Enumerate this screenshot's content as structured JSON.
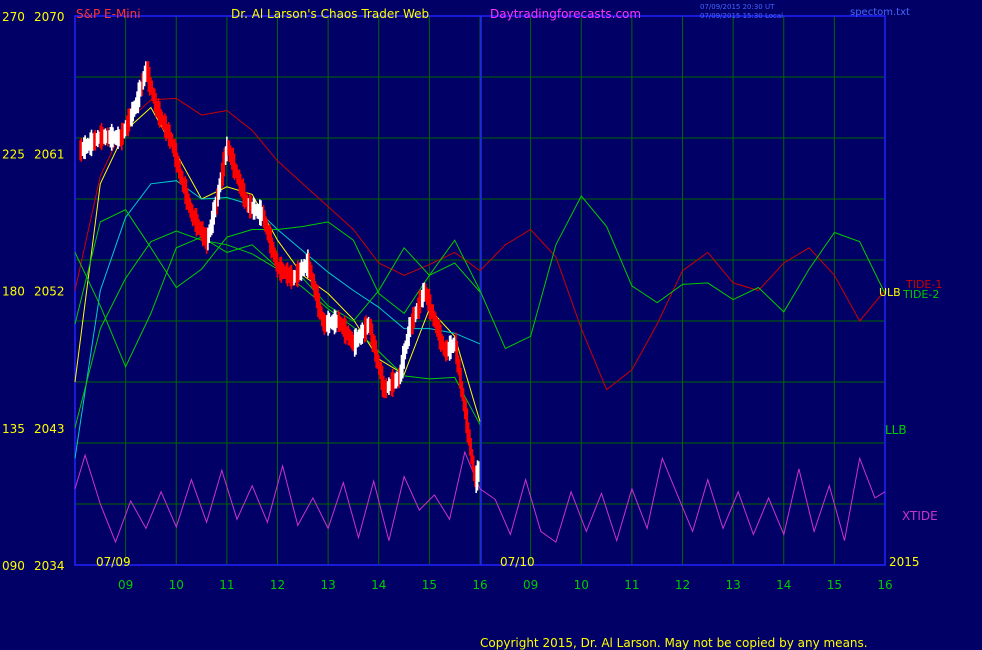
{
  "header": {
    "symbol": "S&P E-Mini",
    "title": "Dr. Al Larson's Chaos Trader Web",
    "site": "Daytradingforecasts.com",
    "stamp1": "07/09/2015 20:30 UT",
    "stamp2": "07/09/2015 15:30 Local",
    "file": "spectom.txt"
  },
  "copyright": "Copyright 2015, Dr. Al Larson. May not be copied by any means.",
  "colors": {
    "background": "#000066",
    "grid": "#006600",
    "frame": "#2222ff",
    "price": "#ffffff",
    "price_down": "#ff0000",
    "yellow_ma": "#ffff00",
    "cyan_ma": "#00cccc",
    "tide1": "#cc0000",
    "tide2": "#00cc00",
    "xtide": "#cc33cc"
  },
  "chart_data": {
    "type": "line",
    "title": "S&P E-Mini",
    "left_axis_labels": [
      "270",
      "225",
      "180",
      "135",
      "090"
    ],
    "right_axis_labels": [
      "2070",
      "2061",
      "2052",
      "2043",
      "2034"
    ],
    "ylim": [
      2034,
      2070
    ],
    "x_ticks": [
      "09",
      "10",
      "11",
      "12",
      "13",
      "14",
      "15",
      "16",
      "09",
      "10",
      "11",
      "12",
      "13",
      "14",
      "15",
      "16"
    ],
    "date_markers": [
      "07/09",
      "07/10"
    ],
    "year_label": "2015",
    "right_labels": {
      "tide1": "TIDE-1",
      "tide2": "TIDE-2",
      "ulb": "ULB",
      "llb": "LLB",
      "xtide": "XTIDE"
    },
    "series": [
      {
        "name": "S&P E-Mini",
        "hour_x": [
          8.1,
          8.5,
          8.9,
          9.2,
          9.4,
          9.6,
          9.9,
          10.1,
          10.3,
          10.6,
          10.8,
          11.0,
          11.2,
          11.4,
          11.7,
          12.0,
          12.3,
          12.6,
          12.9,
          13.2,
          13.5,
          13.8,
          14.1,
          14.4,
          14.6,
          14.9,
          15.1,
          15.3,
          15.5,
          15.7,
          15.9,
          16.0
        ],
        "values": [
          2061.2,
          2062.1,
          2062.0,
          2064.2,
          2066.5,
          2064.0,
          2061.8,
          2059.3,
          2057.0,
          2055.2,
          2058.0,
          2061.5,
          2059.5,
          2057.6,
          2057.0,
          2053.5,
          2052.8,
          2053.8,
          2049.8,
          2050.0,
          2048.5,
          2049.8,
          2045.5,
          2046.3,
          2049.5,
          2052.0,
          2050.0,
          2048.0,
          2048.5,
          2044.0,
          2039.5,
          2040.5
        ]
      },
      {
        "name": "yellow",
        "hour_x": [
          8.0,
          8.5,
          9.0,
          9.5,
          10.0,
          10.5,
          11.0,
          11.5,
          12.0,
          12.5,
          13.0,
          13.5,
          14.0,
          14.5,
          15.0,
          15.5,
          16.0
        ],
        "values": [
          2046.0,
          2059.0,
          2062.5,
          2064.0,
          2061.0,
          2058.0,
          2058.8,
          2058.3,
          2055.3,
          2053.0,
          2051.8,
          2050.1,
          2047.5,
          2046.5,
          2050.8,
          2049.0,
          2043.4
        ]
      },
      {
        "name": "cyan",
        "hour_x": [
          8.0,
          8.5,
          9.0,
          9.5,
          10.0,
          10.5,
          11.0,
          11.5,
          12.0,
          12.5,
          13.0,
          13.5,
          14.0,
          14.5,
          15.0,
          15.5,
          16.0
        ],
        "values": [
          2041.0,
          2052.0,
          2056.8,
          2059.0,
          2059.2,
          2058.0,
          2058.1,
          2057.6,
          2056.0,
          2054.6,
          2053.2,
          2052.0,
          2050.9,
          2049.5,
          2049.5,
          2049.2,
          2048.5
        ]
      },
      {
        "name": "TIDE-1",
        "hour_x": [
          8.0,
          8.5,
          9.0,
          9.5,
          10.0,
          10.5,
          11.0,
          11.5,
          12.0,
          12.5,
          13.0,
          13.5,
          14.0,
          14.5,
          15.0,
          15.5,
          16.0,
          16.5,
          17.0,
          17.5,
          18.0,
          18.5,
          19.0,
          19.5,
          20.0,
          20.5,
          21.0,
          21.5,
          22.0,
          22.5,
          23.0,
          23.5,
          24.0
        ],
        "values": [
          2052.0,
          2059.5,
          2063.0,
          2064.5,
          2064.6,
          2063.5,
          2063.8,
          2062.5,
          2060.5,
          2059.0,
          2057.5,
          2056.0,
          2053.8,
          2053.0,
          2053.7,
          2054.5,
          2053.3,
          2055.0,
          2056.0,
          2054.2,
          2049.5,
          2045.5,
          2046.8,
          2049.8,
          2053.3,
          2054.5,
          2052.5,
          2052.0,
          2053.8,
          2054.8,
          2053.0,
          2050.0,
          2052.0
        ]
      },
      {
        "name": "TIDE-2",
        "hour_x": [
          8.0,
          8.5,
          9.0,
          9.5,
          10.0,
          10.5,
          11.0,
          11.5,
          12.0,
          12.5,
          13.0,
          13.5,
          14.0,
          14.5,
          15.0,
          15.5,
          16.0,
          16.5,
          17.0,
          17.5,
          18.0,
          18.5,
          19.0,
          19.5,
          20.0,
          20.5,
          21.0,
          21.5,
          22.0,
          22.5,
          23.0,
          23.5,
          24.0
        ],
        "values": [
          2054.5,
          2051.0,
          2047.0,
          2050.5,
          2054.8,
          2055.5,
          2054.5,
          2055.0,
          2053.5,
          2052.8,
          2051.0,
          2050.0,
          2052.0,
          2054.8,
          2053.0,
          2055.3,
          2052.0,
          2048.2,
          2049.0,
          2055.0,
          2058.2,
          2056.2,
          2052.3,
          2051.2,
          2052.4,
          2052.5,
          2051.4,
          2052.2,
          2050.6,
          2053.4,
          2055.8,
          2055.2,
          2051.8
        ]
      },
      {
        "name": "ULB",
        "hour_x": [
          8.0,
          8.5,
          9.0,
          9.5,
          10.0,
          10.5,
          11.0,
          11.5,
          12.0,
          12.5,
          13.0,
          13.5,
          14.0,
          14.5,
          15.0,
          15.5,
          16.0
        ],
        "values": [
          2049.8,
          2056.5,
          2057.3,
          2054.8,
          2052.2,
          2053.4,
          2055.5,
          2056.0,
          2056.0,
          2056.2,
          2056.5,
          2055.3,
          2051.8,
          2050.5,
          2053.0,
          2053.8,
          2051.9
        ]
      },
      {
        "name": "LLB",
        "hour_x": [
          8.0,
          8.5,
          9.0,
          9.5,
          10.0,
          10.5,
          11.0,
          11.5,
          12.0,
          12.5,
          13.0,
          13.5,
          14.0,
          14.5,
          15.0,
          15.5,
          16.0
        ],
        "values": [
          2043.0,
          2049.5,
          2052.8,
          2055.2,
          2055.9,
          2055.3,
          2055.0,
          2054.4,
          2053.4,
          2052.2,
          2050.8,
          2049.6,
          2048.0,
          2046.4,
          2046.2,
          2046.3,
          2043.2
        ]
      },
      {
        "name": "XTIDE",
        "hour_x": [
          8.0,
          8.2,
          8.5,
          8.8,
          9.1,
          9.4,
          9.7,
          10.0,
          10.3,
          10.6,
          10.9,
          11.2,
          11.5,
          11.8,
          12.1,
          12.4,
          12.7,
          13.0,
          13.3,
          13.6,
          13.9,
          14.2,
          14.5,
          14.8,
          15.1,
          15.4,
          15.7,
          16.0,
          16.3,
          16.6,
          16.9,
          17.2,
          17.5,
          17.8,
          18.1,
          18.4,
          18.7,
          19.0,
          19.3,
          19.6,
          19.9,
          20.2,
          20.5,
          20.8,
          21.1,
          21.4,
          21.7,
          22.0,
          22.3,
          22.6,
          22.9,
          23.2,
          23.5,
          23.8,
          24.0
        ],
        "values": [
          2039.0,
          2041.2,
          2038.0,
          2035.5,
          2038.2,
          2036.4,
          2038.8,
          2036.5,
          2039.6,
          2036.8,
          2040.2,
          2037.0,
          2039.2,
          2036.8,
          2040.5,
          2036.6,
          2038.4,
          2036.4,
          2039.4,
          2035.8,
          2039.5,
          2035.6,
          2039.8,
          2037.6,
          2038.6,
          2037.0,
          2041.4,
          2039.0,
          2038.3,
          2036.0,
          2039.6,
          2036.2,
          2035.5,
          2038.8,
          2036.2,
          2038.7,
          2035.6,
          2039.0,
          2036.4,
          2041.0,
          2038.6,
          2036.2,
          2039.6,
          2036.4,
          2038.8,
          2036.0,
          2038.4,
          2036.0,
          2040.3,
          2036.2,
          2039.2,
          2035.6,
          2041.0,
          2038.4,
          2038.8
        ]
      }
    ]
  }
}
